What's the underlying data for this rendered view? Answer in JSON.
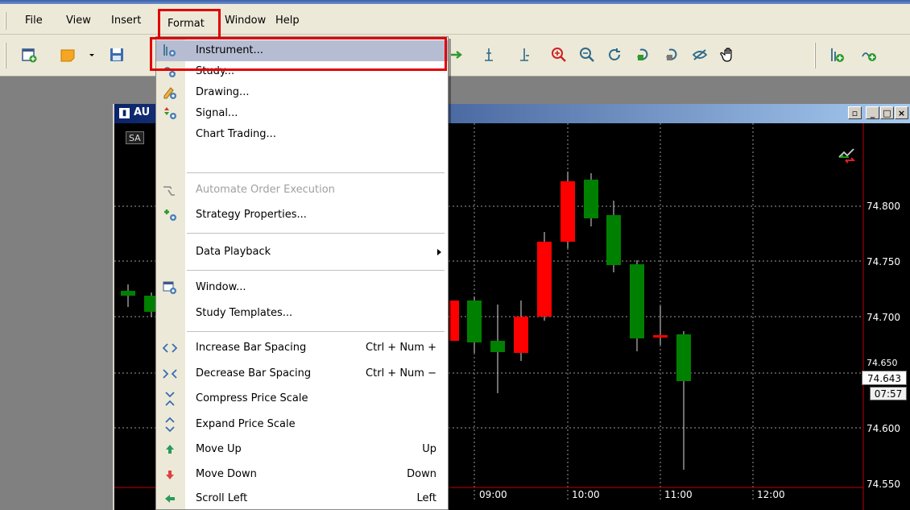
{
  "menubar": {
    "items": [
      "File",
      "View",
      "Insert",
      "Format",
      "Window",
      "Help"
    ]
  },
  "toolbar": {
    "left_icons": [
      "new-chart-icon",
      "note-icon",
      "dropdown-arrow-icon",
      "save-icon"
    ],
    "right_icons": [
      "arrow-right-icon",
      "marker-icon",
      "marker-2-icon",
      "zoom-in-icon",
      "zoom-out-icon",
      "rotate-icon",
      "refresh-icon",
      "refresh-2-icon",
      "hide-icon",
      "hand-icon",
      "add-indicator-icon",
      "settings-icon"
    ]
  },
  "chart_window": {
    "title": "AU",
    "badge": "SA",
    "price_labels": [
      "74.800",
      "74.750",
      "74.700",
      "74.650",
      "74.600",
      "74.550"
    ],
    "time_labels": [
      "09:00",
      "10:00",
      "11:00",
      "12:00"
    ],
    "current_price": "74.643",
    "current_time": "07:57",
    "colors": {
      "up": "#008000",
      "down": "#ff0000",
      "background": "#000000"
    }
  },
  "format_menu": {
    "items": [
      {
        "label": "Instrument...",
        "icon": "instrument-gear-icon",
        "shortcut": "",
        "disabled": false,
        "highlight": true
      },
      {
        "label": "Study...",
        "icon": "study-gear-icon",
        "shortcut": "",
        "disabled": false
      },
      {
        "label": "Drawing...",
        "icon": "drawing-pencil-icon",
        "shortcut": "",
        "disabled": false
      },
      {
        "label": "Signal...",
        "icon": "signal-gear-icon",
        "shortcut": "",
        "disabled": false
      },
      {
        "label": "Chart Trading...",
        "icon": "",
        "shortcut": "",
        "disabled": false
      },
      {
        "label": "Automate Order Execution",
        "icon": "automate-icon",
        "shortcut": "",
        "disabled": true
      },
      {
        "label": "Strategy Properties...",
        "icon": "strategy-gear-icon",
        "shortcut": "",
        "disabled": false
      },
      {
        "label": "Data Playback",
        "icon": "",
        "shortcut": "",
        "disabled": false,
        "submenu": true
      },
      {
        "label": "Window...",
        "icon": "window-gear-icon",
        "shortcut": "",
        "disabled": false
      },
      {
        "label": "Study Templates...",
        "icon": "",
        "shortcut": "",
        "disabled": false
      },
      {
        "label": "Increase Bar Spacing",
        "icon": "increase-spacing-icon",
        "shortcut": "Ctrl + Num +",
        "disabled": false
      },
      {
        "label": "Decrease Bar Spacing",
        "icon": "decrease-spacing-icon",
        "shortcut": "Ctrl + Num −",
        "disabled": false
      },
      {
        "label": "Compress Price Scale",
        "icon": "compress-icon",
        "shortcut": "",
        "disabled": false
      },
      {
        "label": "Expand Price Scale",
        "icon": "expand-icon",
        "shortcut": "",
        "disabled": false
      },
      {
        "label": "Move Up",
        "icon": "move-up-icon",
        "shortcut": "Up",
        "disabled": false
      },
      {
        "label": "Move Down",
        "icon": "move-down-icon",
        "shortcut": "Down",
        "disabled": false
      },
      {
        "label": "Scroll Left",
        "icon": "scroll-left-icon",
        "shortcut": "Left",
        "disabled": false
      }
    ]
  }
}
